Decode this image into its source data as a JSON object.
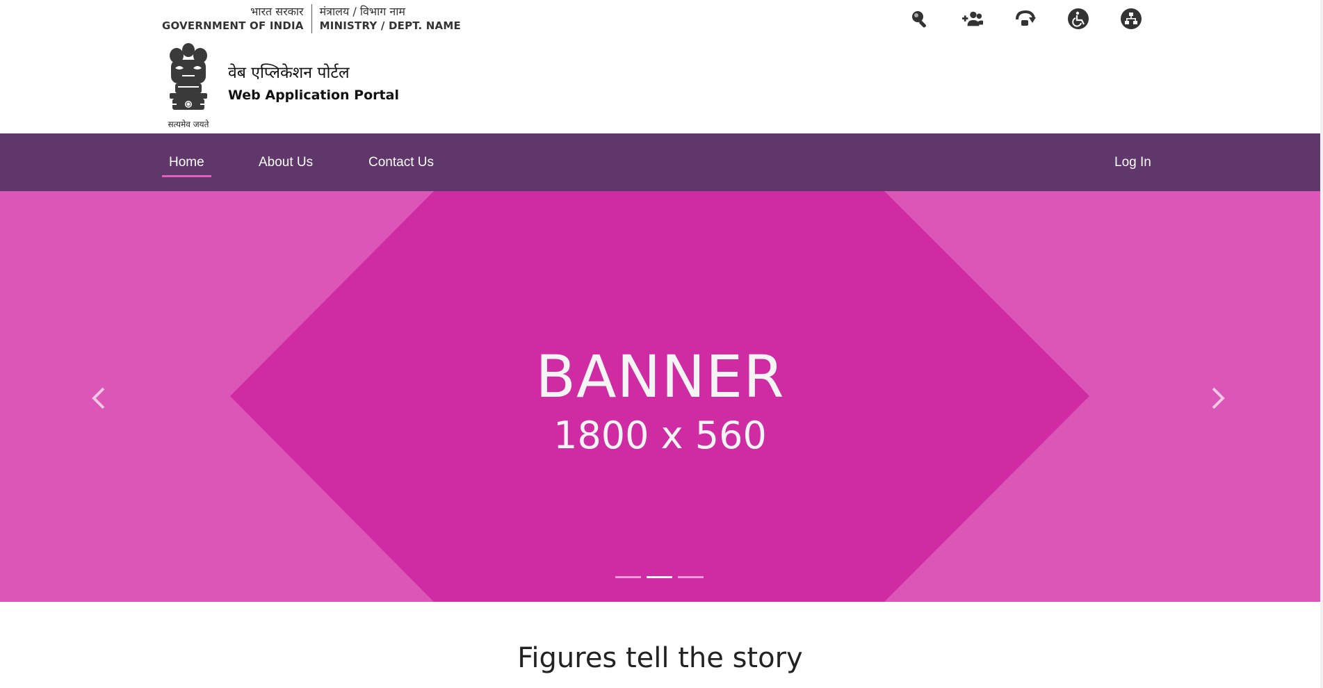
{
  "header": {
    "gov_hindi": "भारत सरकार",
    "gov_english": "GOVERNMENT OF INDIA",
    "ministry_hindi": "मंत्रालय / विभाग नाम",
    "ministry_english": "MINISTRY / DEPT. NAME",
    "emblem_caption": "सत्यमेव जयते",
    "portal_title_hindi": "वेब एप्लिकेशन पोर्टल",
    "portal_title_english": "Web Application Portal",
    "tools": [
      {
        "icon": "search-icon"
      },
      {
        "icon": "sitemap-users-icon"
      },
      {
        "icon": "skip-to-content-icon"
      },
      {
        "icon": "accessibility-icon"
      },
      {
        "icon": "sitemap-icon"
      }
    ]
  },
  "nav": {
    "items": [
      {
        "label": "Home",
        "active": true
      },
      {
        "label": "About Us",
        "active": false
      },
      {
        "label": "Contact Us",
        "active": false
      }
    ],
    "login_label": "Log In"
  },
  "banner": {
    "title": "BANNER",
    "subtitle": "1800 x 560",
    "slides": 3,
    "active_slide": 2
  },
  "section": {
    "title": "Figures tell the story"
  },
  "colors": {
    "nav_bg": "#5f376b",
    "nav_active_underline": "#e45ec4",
    "banner_outer": "#db56b6",
    "banner_inner": "#cf2ca3",
    "icon_dark": "#333333"
  }
}
